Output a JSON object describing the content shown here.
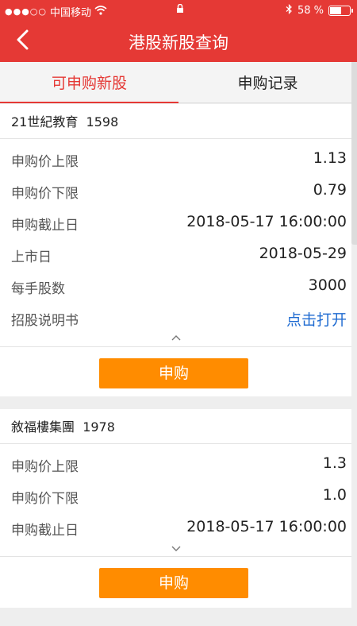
{
  "status_bar": {
    "signal": "●●●○○",
    "carrier": "中国移动",
    "wifi_icon": "wifi-icon",
    "lock_icon": "lock-icon",
    "bluetooth_icon": "bluetooth-icon",
    "battery_text": "58 %",
    "battery_level": 0.58
  },
  "nav": {
    "title": "港股新股查询",
    "back_icon": "chevron-left-icon"
  },
  "tabs": [
    {
      "label": "可申购新股",
      "active": true
    },
    {
      "label": "申购记录",
      "active": false
    }
  ],
  "stocks": [
    {
      "name": "21世紀教育",
      "code": "1598",
      "rows": [
        {
          "label": "申购价上限",
          "value": "1.13"
        },
        {
          "label": "申购价下限",
          "value": "0.79"
        },
        {
          "label": "申购截止日",
          "value": "2018-05-17 16:00:00"
        },
        {
          "label": "上市日",
          "value": "2018-05-29"
        },
        {
          "label": "每手股数",
          "value": "3000"
        },
        {
          "label": "招股说明书",
          "value": "点击打开"
        }
      ],
      "toggle": "^",
      "button": "申购"
    },
    {
      "name": "敘福樓集團",
      "code": "1978",
      "rows": [
        {
          "label": "申购价上限",
          "value": "1.3"
        },
        {
          "label": "申购价下限",
          "value": "1.0"
        },
        {
          "label": "申购截止日",
          "value": "2018-05-17 16:00:00"
        }
      ],
      "toggle": "⌄",
      "button": "申购"
    }
  ],
  "colors": {
    "brand_red": "#e53935",
    "button_orange": "#ff8c00",
    "link_blue": "#1f6bd1"
  }
}
